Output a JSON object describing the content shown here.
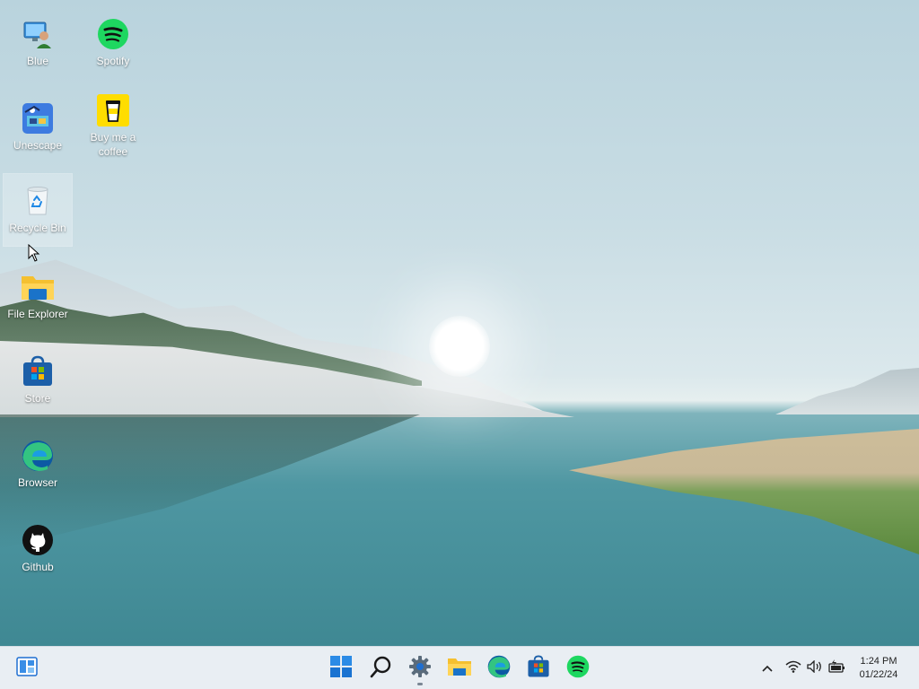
{
  "desktop": {
    "icons": [
      {
        "label": "Blue",
        "icon": "user-monitor-icon"
      },
      {
        "label": "Spotify",
        "icon": "spotify-icon"
      },
      {
        "label": "Unescape",
        "icon": "unescape-icon"
      },
      {
        "label": "Buy me a coffee",
        "icon": "coffee-cup-icon"
      },
      {
        "label": "Recycle Bin",
        "icon": "recycle-bin-icon"
      },
      {
        "label": "File Explorer",
        "icon": "folder-icon"
      },
      {
        "label": "Store",
        "icon": "store-icon"
      },
      {
        "label": "Browser",
        "icon": "edge-icon"
      },
      {
        "label": "Github",
        "icon": "github-icon"
      }
    ]
  },
  "taskbar": {
    "widgets_icon": "widgets-icon",
    "apps": [
      {
        "name": "Start",
        "icon": "windows-start-icon"
      },
      {
        "name": "Search",
        "icon": "search-icon"
      },
      {
        "name": "Settings",
        "icon": "gear-icon"
      },
      {
        "name": "File Explorer",
        "icon": "folder-icon"
      },
      {
        "name": "Edge",
        "icon": "edge-icon"
      },
      {
        "name": "Store",
        "icon": "store-icon"
      },
      {
        "name": "Spotify",
        "icon": "spotify-icon"
      }
    ],
    "tray": {
      "icons": [
        "chevron-up-icon",
        "wifi-icon",
        "speaker-icon",
        "battery-icon"
      ],
      "time": "1:24 PM",
      "date": "01/22/24"
    }
  },
  "colors": {
    "taskbar_bg": "#e9eef3",
    "spotify_green": "#1ed760",
    "windows_blue": "#0a7ad6",
    "coffee_yellow": "#ffdd00",
    "folder_yellow": "#f5c030"
  }
}
